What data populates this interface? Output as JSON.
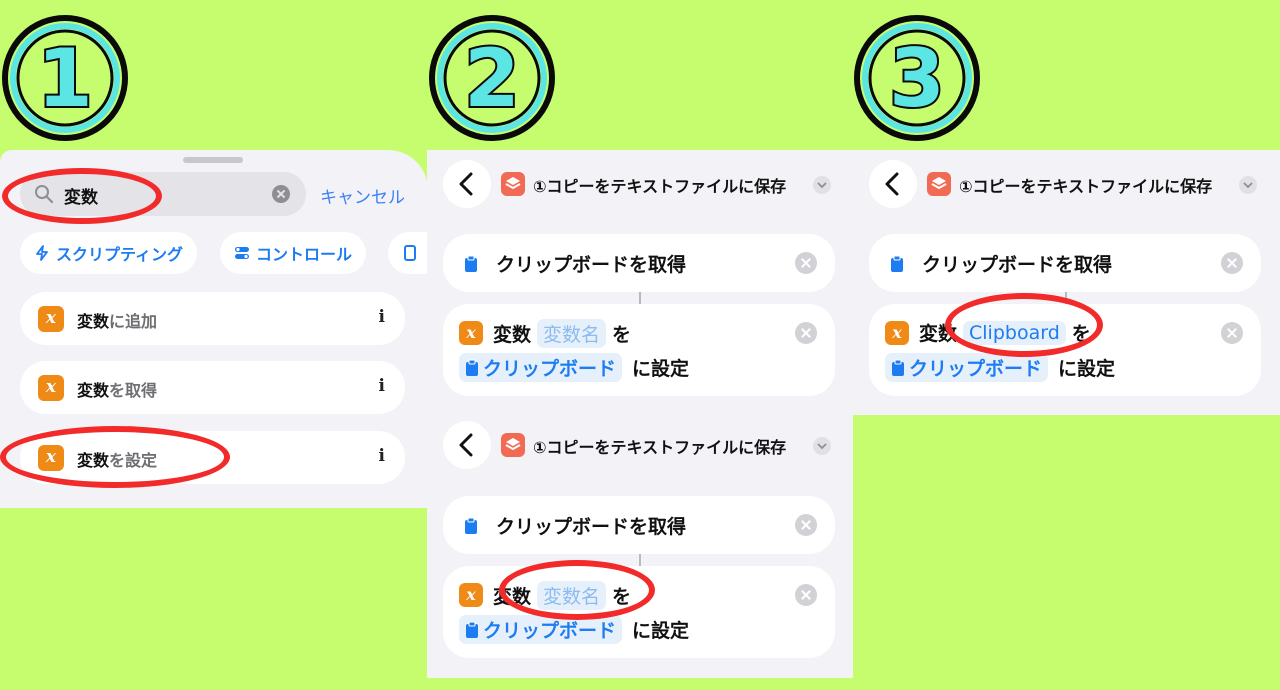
{
  "step_numbers": [
    "1",
    "2",
    "3"
  ],
  "colors": {
    "background": "#c6fd6f",
    "accent": "#1d7cf2",
    "variable_badge": "#f08a16",
    "shortcut_icon": "#f16b54",
    "highlight": "#f22a2a",
    "step_fill": "#5be6e4"
  },
  "panel1": {
    "search": {
      "value": "変数",
      "icon": "search-icon"
    },
    "cancel_label": "キャンセル",
    "chips": [
      {
        "label": "スクリプティング",
        "icon": "scripting-icon"
      },
      {
        "label": "コントロール",
        "icon": "control-icon"
      }
    ],
    "actions": [
      {
        "keyword": "変数",
        "rest": "に追加",
        "badge": "x",
        "info": "i"
      },
      {
        "keyword": "変数",
        "rest": "を取得",
        "badge": "x",
        "info": "i"
      },
      {
        "keyword": "変数",
        "rest": "を設定",
        "badge": "x",
        "info": "i"
      }
    ]
  },
  "shortcut": {
    "title": "①コピーをテキストファイルに保存"
  },
  "get_clipboard_label": "クリップボードを取得",
  "set_variable": {
    "badge": "x",
    "prefix": "変数",
    "placeholder": "変数名",
    "filled_name": "Clipboard",
    "particle": "を",
    "clip_token": "クリップボード",
    "suffix": "に設定"
  }
}
